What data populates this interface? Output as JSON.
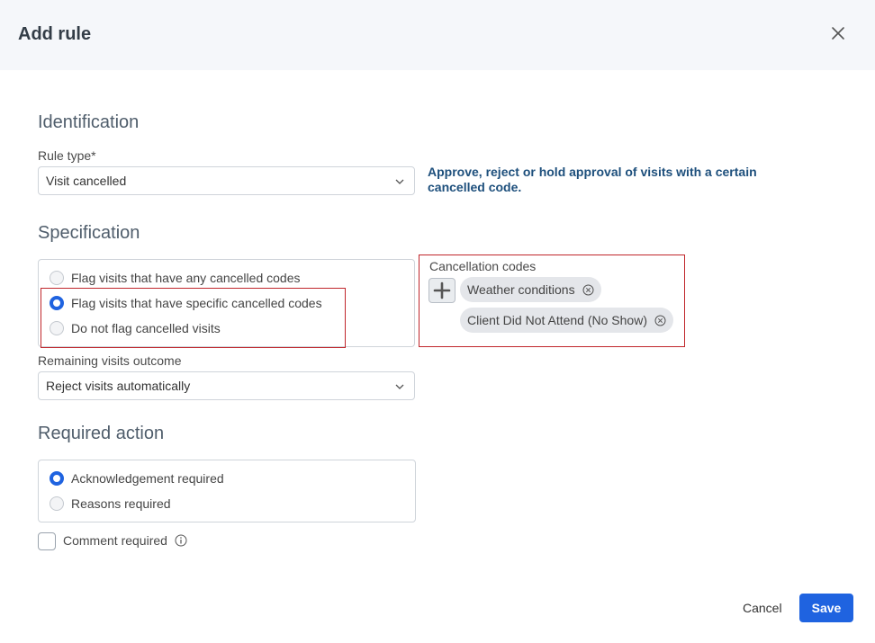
{
  "dialog": {
    "title": "Add rule",
    "close_icon": "close-icon"
  },
  "identification": {
    "heading": "Identification",
    "rule_type_label": "Rule type",
    "required_marker": "*",
    "rule_type_value": "Visit cancelled",
    "description": "Approve, reject or hold approval of visits with a certain cancelled code."
  },
  "specification": {
    "heading": "Specification",
    "options": [
      {
        "label": "Flag visits that have any cancelled codes",
        "checked": false
      },
      {
        "label": "Flag visits that have specific cancelled codes",
        "checked": true
      },
      {
        "label": "Do not flag cancelled visits",
        "checked": false
      }
    ],
    "cancellation_codes_label": "Cancellation codes",
    "codes": [
      "Weather conditions",
      "Client Did Not Attend (No Show)"
    ],
    "remaining_outcome_label": "Remaining visits outcome",
    "remaining_outcome_value": "Reject visits automatically"
  },
  "required_action": {
    "heading": "Required action",
    "options": [
      {
        "label": "Acknowledgement required",
        "checked": true
      },
      {
        "label": "Reasons required",
        "checked": false
      }
    ],
    "comment_label": "Comment required",
    "comment_checked": false
  },
  "footer": {
    "cancel_label": "Cancel",
    "save_label": "Save"
  },
  "colors": {
    "accent": "#1f63e0",
    "highlight_frame": "#c0262b",
    "description_text": "#1d4f7c"
  }
}
